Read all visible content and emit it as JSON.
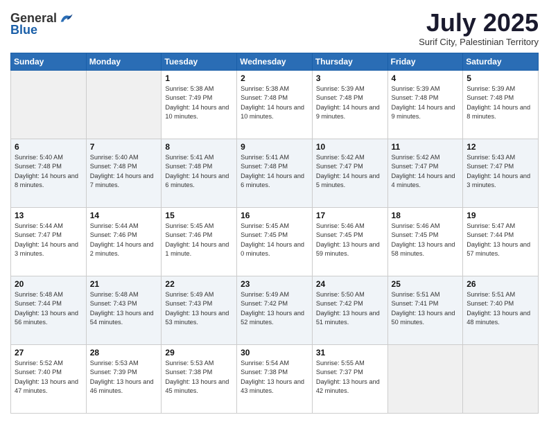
{
  "header": {
    "logo_general": "General",
    "logo_blue": "Blue",
    "month": "July 2025",
    "location": "Surif City, Palestinian Territory"
  },
  "weekdays": [
    "Sunday",
    "Monday",
    "Tuesday",
    "Wednesday",
    "Thursday",
    "Friday",
    "Saturday"
  ],
  "weeks": [
    [
      {
        "day": "",
        "sunrise": "",
        "sunset": "",
        "daylight": ""
      },
      {
        "day": "",
        "sunrise": "",
        "sunset": "",
        "daylight": ""
      },
      {
        "day": "1",
        "sunrise": "Sunrise: 5:38 AM",
        "sunset": "Sunset: 7:49 PM",
        "daylight": "Daylight: 14 hours and 10 minutes."
      },
      {
        "day": "2",
        "sunrise": "Sunrise: 5:38 AM",
        "sunset": "Sunset: 7:48 PM",
        "daylight": "Daylight: 14 hours and 10 minutes."
      },
      {
        "day": "3",
        "sunrise": "Sunrise: 5:39 AM",
        "sunset": "Sunset: 7:48 PM",
        "daylight": "Daylight: 14 hours and 9 minutes."
      },
      {
        "day": "4",
        "sunrise": "Sunrise: 5:39 AM",
        "sunset": "Sunset: 7:48 PM",
        "daylight": "Daylight: 14 hours and 9 minutes."
      },
      {
        "day": "5",
        "sunrise": "Sunrise: 5:39 AM",
        "sunset": "Sunset: 7:48 PM",
        "daylight": "Daylight: 14 hours and 8 minutes."
      }
    ],
    [
      {
        "day": "6",
        "sunrise": "Sunrise: 5:40 AM",
        "sunset": "Sunset: 7:48 PM",
        "daylight": "Daylight: 14 hours and 8 minutes."
      },
      {
        "day": "7",
        "sunrise": "Sunrise: 5:40 AM",
        "sunset": "Sunset: 7:48 PM",
        "daylight": "Daylight: 14 hours and 7 minutes."
      },
      {
        "day": "8",
        "sunrise": "Sunrise: 5:41 AM",
        "sunset": "Sunset: 7:48 PM",
        "daylight": "Daylight: 14 hours and 6 minutes."
      },
      {
        "day": "9",
        "sunrise": "Sunrise: 5:41 AM",
        "sunset": "Sunset: 7:48 PM",
        "daylight": "Daylight: 14 hours and 6 minutes."
      },
      {
        "day": "10",
        "sunrise": "Sunrise: 5:42 AM",
        "sunset": "Sunset: 7:47 PM",
        "daylight": "Daylight: 14 hours and 5 minutes."
      },
      {
        "day": "11",
        "sunrise": "Sunrise: 5:42 AM",
        "sunset": "Sunset: 7:47 PM",
        "daylight": "Daylight: 14 hours and 4 minutes."
      },
      {
        "day": "12",
        "sunrise": "Sunrise: 5:43 AM",
        "sunset": "Sunset: 7:47 PM",
        "daylight": "Daylight: 14 hours and 3 minutes."
      }
    ],
    [
      {
        "day": "13",
        "sunrise": "Sunrise: 5:44 AM",
        "sunset": "Sunset: 7:47 PM",
        "daylight": "Daylight: 14 hours and 3 minutes."
      },
      {
        "day": "14",
        "sunrise": "Sunrise: 5:44 AM",
        "sunset": "Sunset: 7:46 PM",
        "daylight": "Daylight: 14 hours and 2 minutes."
      },
      {
        "day": "15",
        "sunrise": "Sunrise: 5:45 AM",
        "sunset": "Sunset: 7:46 PM",
        "daylight": "Daylight: 14 hours and 1 minute."
      },
      {
        "day": "16",
        "sunrise": "Sunrise: 5:45 AM",
        "sunset": "Sunset: 7:45 PM",
        "daylight": "Daylight: 14 hours and 0 minutes."
      },
      {
        "day": "17",
        "sunrise": "Sunrise: 5:46 AM",
        "sunset": "Sunset: 7:45 PM",
        "daylight": "Daylight: 13 hours and 59 minutes."
      },
      {
        "day": "18",
        "sunrise": "Sunrise: 5:46 AM",
        "sunset": "Sunset: 7:45 PM",
        "daylight": "Daylight: 13 hours and 58 minutes."
      },
      {
        "day": "19",
        "sunrise": "Sunrise: 5:47 AM",
        "sunset": "Sunset: 7:44 PM",
        "daylight": "Daylight: 13 hours and 57 minutes."
      }
    ],
    [
      {
        "day": "20",
        "sunrise": "Sunrise: 5:48 AM",
        "sunset": "Sunset: 7:44 PM",
        "daylight": "Daylight: 13 hours and 56 minutes."
      },
      {
        "day": "21",
        "sunrise": "Sunrise: 5:48 AM",
        "sunset": "Sunset: 7:43 PM",
        "daylight": "Daylight: 13 hours and 54 minutes."
      },
      {
        "day": "22",
        "sunrise": "Sunrise: 5:49 AM",
        "sunset": "Sunset: 7:43 PM",
        "daylight": "Daylight: 13 hours and 53 minutes."
      },
      {
        "day": "23",
        "sunrise": "Sunrise: 5:49 AM",
        "sunset": "Sunset: 7:42 PM",
        "daylight": "Daylight: 13 hours and 52 minutes."
      },
      {
        "day": "24",
        "sunrise": "Sunrise: 5:50 AM",
        "sunset": "Sunset: 7:42 PM",
        "daylight": "Daylight: 13 hours and 51 minutes."
      },
      {
        "day": "25",
        "sunrise": "Sunrise: 5:51 AM",
        "sunset": "Sunset: 7:41 PM",
        "daylight": "Daylight: 13 hours and 50 minutes."
      },
      {
        "day": "26",
        "sunrise": "Sunrise: 5:51 AM",
        "sunset": "Sunset: 7:40 PM",
        "daylight": "Daylight: 13 hours and 48 minutes."
      }
    ],
    [
      {
        "day": "27",
        "sunrise": "Sunrise: 5:52 AM",
        "sunset": "Sunset: 7:40 PM",
        "daylight": "Daylight: 13 hours and 47 minutes."
      },
      {
        "day": "28",
        "sunrise": "Sunrise: 5:53 AM",
        "sunset": "Sunset: 7:39 PM",
        "daylight": "Daylight: 13 hours and 46 minutes."
      },
      {
        "day": "29",
        "sunrise": "Sunrise: 5:53 AM",
        "sunset": "Sunset: 7:38 PM",
        "daylight": "Daylight: 13 hours and 45 minutes."
      },
      {
        "day": "30",
        "sunrise": "Sunrise: 5:54 AM",
        "sunset": "Sunset: 7:38 PM",
        "daylight": "Daylight: 13 hours and 43 minutes."
      },
      {
        "day": "31",
        "sunrise": "Sunrise: 5:55 AM",
        "sunset": "Sunset: 7:37 PM",
        "daylight": "Daylight: 13 hours and 42 minutes."
      },
      {
        "day": "",
        "sunrise": "",
        "sunset": "",
        "daylight": ""
      },
      {
        "day": "",
        "sunrise": "",
        "sunset": "",
        "daylight": ""
      }
    ]
  ]
}
